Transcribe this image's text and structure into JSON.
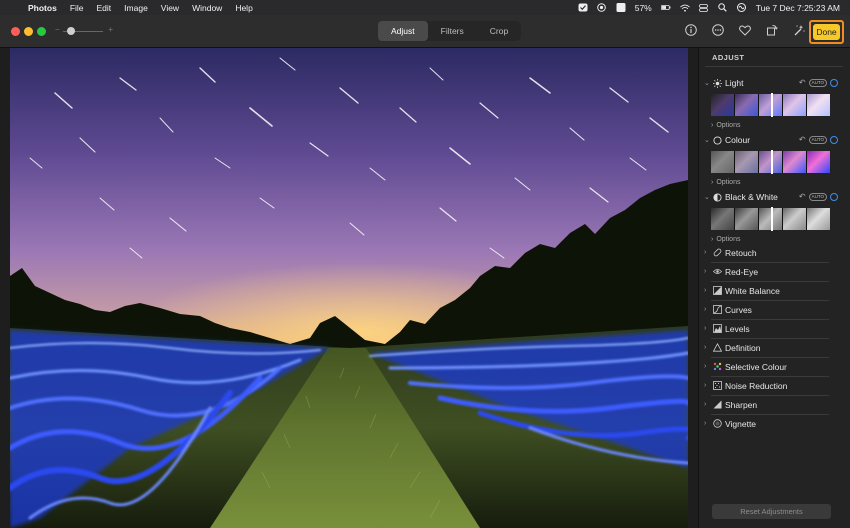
{
  "menubar": {
    "app_name": "Photos",
    "items": [
      "File",
      "Edit",
      "Image",
      "View",
      "Window",
      "Help"
    ],
    "battery": "57%",
    "clock": "Tue 7 Dec  7:25:23 AM",
    "input_source": "A"
  },
  "toolbar": {
    "tabs": [
      "Adjust",
      "Filters",
      "Crop"
    ],
    "active_tab": "Adjust",
    "zoom_minus": "−",
    "zoom_plus": "+",
    "done_label": "Done",
    "accent": "#f7c82a",
    "highlight": "#f08c23"
  },
  "sidebar": {
    "title": "ADJUST",
    "expanded_sections": [
      {
        "label": "Light",
        "icon": "sun-icon",
        "auto": "AUTO",
        "options": "Options"
      },
      {
        "label": "Colour",
        "icon": "circle-icon",
        "auto": "AUTO",
        "options": "Options"
      },
      {
        "label": "Black & White",
        "icon": "half-circle-icon",
        "auto": "AUTO",
        "options": "Options"
      }
    ],
    "tools": [
      {
        "label": "Retouch",
        "icon": "bandage-icon"
      },
      {
        "label": "Red-Eye",
        "icon": "eye-icon"
      },
      {
        "label": "White Balance",
        "icon": "white-balance-icon"
      },
      {
        "label": "Curves",
        "icon": "curves-icon"
      },
      {
        "label": "Levels",
        "icon": "levels-icon"
      },
      {
        "label": "Definition",
        "icon": "triangle-icon"
      },
      {
        "label": "Selective Colour",
        "icon": "dots-icon"
      },
      {
        "label": "Noise Reduction",
        "icon": "noise-icon"
      },
      {
        "label": "Sharpen",
        "icon": "sharpen-icon"
      },
      {
        "label": "Vignette",
        "icon": "vignette-icon"
      }
    ],
    "reset_label": "Reset Adjustments"
  }
}
